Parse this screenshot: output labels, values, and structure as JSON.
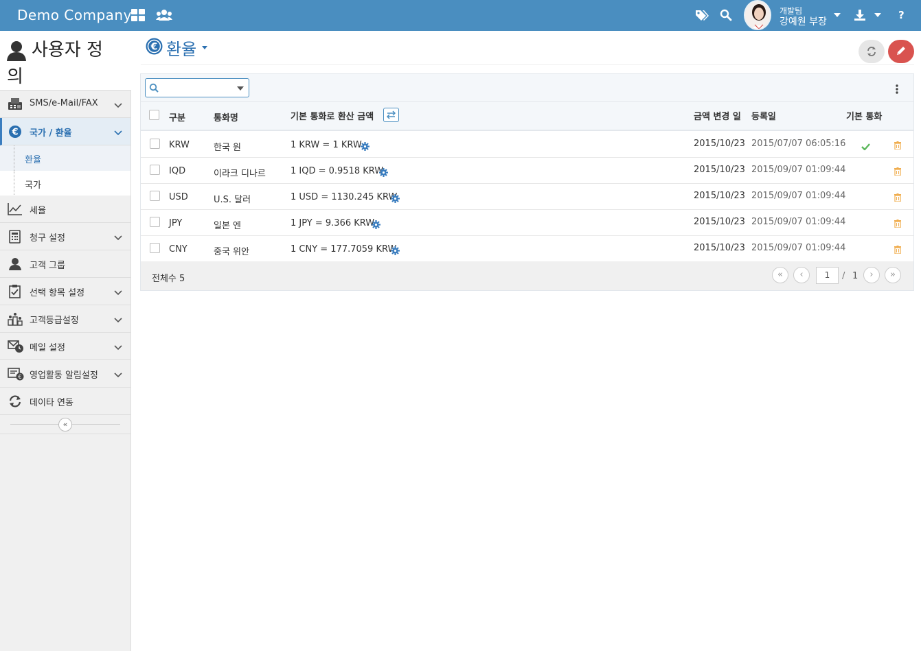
{
  "topbar": {
    "brand": "Demo Company",
    "user_team": "개발팀",
    "user_name": "강예원 부장",
    "icons": [
      "grid-icon",
      "users-icon",
      "tags-icon",
      "search-icon",
      "download-icon",
      "help-icon"
    ]
  },
  "sidebar": {
    "title": "사용자 정",
    "title_cont": "의",
    "items": [
      {
        "label": "SMS/e-Mail/FAX",
        "icon": "fax-icon",
        "expandable": true
      },
      {
        "label": "국가 / 환율",
        "icon": "euro-icon",
        "expandable": true,
        "active": true
      },
      {
        "label": "세율",
        "icon": "line-chart-icon",
        "expandable": false
      },
      {
        "label": "청구 설정",
        "icon": "calculator-icon",
        "expandable": true
      },
      {
        "label": "고객 그룹",
        "icon": "user-icon",
        "expandable": false
      },
      {
        "label": "선택 항목 설정",
        "icon": "checklist-icon",
        "expandable": true
      },
      {
        "label": "고객등급설정",
        "icon": "ranking-icon",
        "expandable": true
      },
      {
        "label": "메일 설정",
        "icon": "mail-clock-icon",
        "expandable": true
      },
      {
        "label": "영업활동 알림설정",
        "icon": "notification-icon",
        "expandable": true
      },
      {
        "label": "데이타 연동",
        "icon": "sync-icon",
        "expandable": false
      }
    ],
    "sub_items": [
      {
        "label": "환율",
        "selected": true
      },
      {
        "label": "국가",
        "selected": false
      }
    ]
  },
  "page": {
    "title": "환율"
  },
  "grid": {
    "columns": {
      "kind": "구분",
      "currency_name": "통화명",
      "conversion": "기본 통화로 환산 금액",
      "changed_date": "금액 변경 일",
      "registered": "등록일",
      "base_currency": "기본 통화"
    },
    "rows": [
      {
        "code": "KRW",
        "name": "한국 원",
        "conversion": "1 KRW = 1 KRW",
        "changed": "2015/10/23",
        "registered": "2015/07/07 06:05:16",
        "is_base": true
      },
      {
        "code": "IQD",
        "name": "이라크 디나르",
        "conversion": "1 IQD = 0.9518 KRW",
        "changed": "2015/10/23",
        "registered": "2015/09/07 01:09:44",
        "is_base": false
      },
      {
        "code": "USD",
        "name": "U.S. 달러",
        "conversion": "1 USD = 1130.245 KRW",
        "changed": "2015/10/23",
        "registered": "2015/09/07 01:09:44",
        "is_base": false
      },
      {
        "code": "JPY",
        "name": "일본 엔",
        "conversion": "1 JPY = 9.366 KRW",
        "changed": "2015/10/23",
        "registered": "2015/09/07 01:09:44",
        "is_base": false
      },
      {
        "code": "CNY",
        "name": "중국 위안",
        "conversion": "1 CNY = 177.7059 KRW",
        "changed": "2015/10/23",
        "registered": "2015/09/07 01:09:44",
        "is_base": false
      }
    ],
    "footer": {
      "total_label": "전체수 5",
      "page_current": "1",
      "page_sep": "/",
      "page_total": "1"
    }
  },
  "colors": {
    "topbar": "#4a8ec0",
    "accent": "#2a6fb0",
    "edit_button": "#d9534f",
    "check": "#5cb85c",
    "trash": "#f0ad4e"
  }
}
